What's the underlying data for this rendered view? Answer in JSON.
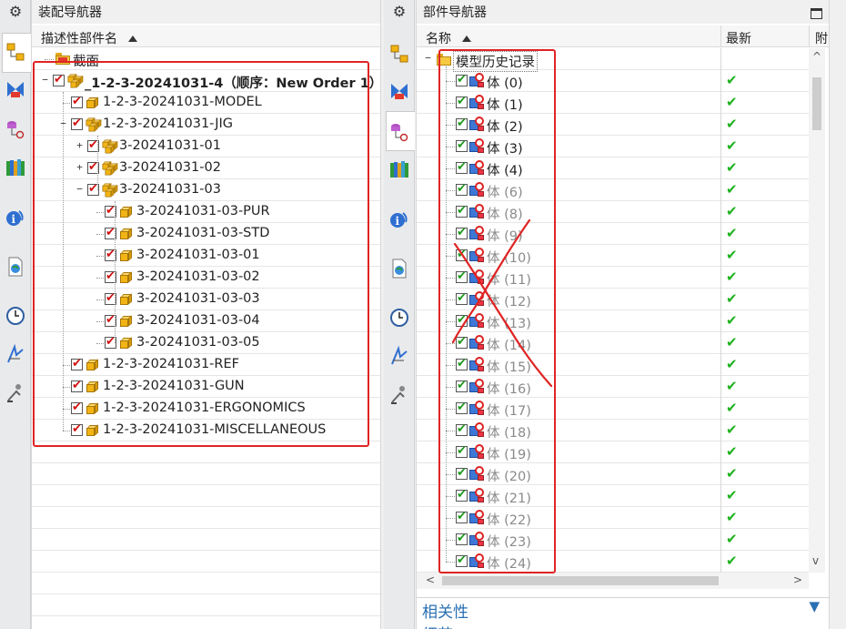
{
  "assembly_navigator": {
    "title": "装配导航器",
    "column_header": "描述性部件名",
    "nodes": [
      {
        "label": "截面",
        "level": 0,
        "type": "folder",
        "expander": "",
        "checked": false
      },
      {
        "label": "_1-2-3-20241031-4（顺序：New Order 1）",
        "level": 0,
        "type": "assembly",
        "expander": "−",
        "checked": true,
        "bold": true
      },
      {
        "label": "1-2-3-20241031-MODEL",
        "level": 1,
        "type": "part",
        "expander": "",
        "checked": true
      },
      {
        "label": "1-2-3-20241031-JIG",
        "level": 1,
        "type": "assembly",
        "expander": "−",
        "checked": true
      },
      {
        "label": "3-20241031-01",
        "level": 2,
        "type": "assembly",
        "expander": "+",
        "checked": true
      },
      {
        "label": "3-20241031-02",
        "level": 2,
        "type": "assembly",
        "expander": "+",
        "checked": true
      },
      {
        "label": "3-20241031-03",
        "level": 2,
        "type": "assembly",
        "expander": "−",
        "checked": true
      },
      {
        "label": "3-20241031-03-PUR",
        "level": 3,
        "type": "part",
        "expander": "",
        "checked": true
      },
      {
        "label": "3-20241031-03-STD",
        "level": 3,
        "type": "part",
        "expander": "",
        "checked": true
      },
      {
        "label": "3-20241031-03-01",
        "level": 3,
        "type": "part",
        "expander": "",
        "checked": true
      },
      {
        "label": "3-20241031-03-02",
        "level": 3,
        "type": "part",
        "expander": "",
        "checked": true
      },
      {
        "label": "3-20241031-03-03",
        "level": 3,
        "type": "part",
        "expander": "",
        "checked": true
      },
      {
        "label": "3-20241031-03-04",
        "level": 3,
        "type": "part",
        "expander": "",
        "checked": true
      },
      {
        "label": "3-20241031-03-05",
        "level": 3,
        "type": "part",
        "expander": "",
        "checked": true
      },
      {
        "label": "1-2-3-20241031-REF",
        "level": 1,
        "type": "part",
        "expander": "",
        "checked": true
      },
      {
        "label": "1-2-3-20241031-GUN",
        "level": 1,
        "type": "part",
        "expander": "",
        "checked": true
      },
      {
        "label": "1-2-3-20241031-ERGONOMICS",
        "level": 1,
        "type": "part",
        "expander": "",
        "checked": true
      },
      {
        "label": "1-2-3-20241031-MISCELLANEOUS",
        "level": 1,
        "type": "part",
        "expander": "",
        "checked": true
      }
    ]
  },
  "part_navigator": {
    "title": "部件导航器",
    "columns": [
      "名称",
      "最新",
      "附"
    ],
    "root": {
      "label": "模型历史记录",
      "expander": "−"
    },
    "bodies": [
      {
        "label": "体 (0)",
        "active": true
      },
      {
        "label": "体 (1)",
        "active": true
      },
      {
        "label": "体 (2)",
        "active": true
      },
      {
        "label": "体 (3)",
        "active": true
      },
      {
        "label": "体 (4)",
        "active": true
      },
      {
        "label": "体 (6)",
        "active": false
      },
      {
        "label": "体 (8)",
        "active": false
      },
      {
        "label": "体 (9)",
        "active": false
      },
      {
        "label": "体 (10)",
        "active": false
      },
      {
        "label": "体 (11)",
        "active": false
      },
      {
        "label": "体 (12)",
        "active": false
      },
      {
        "label": "体 (13)",
        "active": false
      },
      {
        "label": "体 (14)",
        "active": false
      },
      {
        "label": "体 (15)",
        "active": false
      },
      {
        "label": "体 (16)",
        "active": false
      },
      {
        "label": "体 (17)",
        "active": false
      },
      {
        "label": "体 (18)",
        "active": false
      },
      {
        "label": "体 (19)",
        "active": false
      },
      {
        "label": "体 (20)",
        "active": false
      },
      {
        "label": "体 (21)",
        "active": false
      },
      {
        "label": "体 (22)",
        "active": false
      },
      {
        "label": "体 (23)",
        "active": false
      },
      {
        "label": "体 (24)",
        "active": false
      }
    ],
    "sections": [
      "相关性",
      "细节"
    ]
  },
  "resource_bar_icons": [
    "settings-gear-icon",
    "assembly-navigator-icon",
    "constraint-navigator-icon",
    "part-navigator-icon",
    "reuse-library-icon",
    "hd3d-tools-icon",
    "web-browser-icon",
    "history-icon",
    "process-studio-icon",
    "roles-icon"
  ],
  "colors": {
    "annotation_red": "#e02424",
    "accent_blue": "#2a6fb3",
    "check_green": "#1eb21e"
  }
}
